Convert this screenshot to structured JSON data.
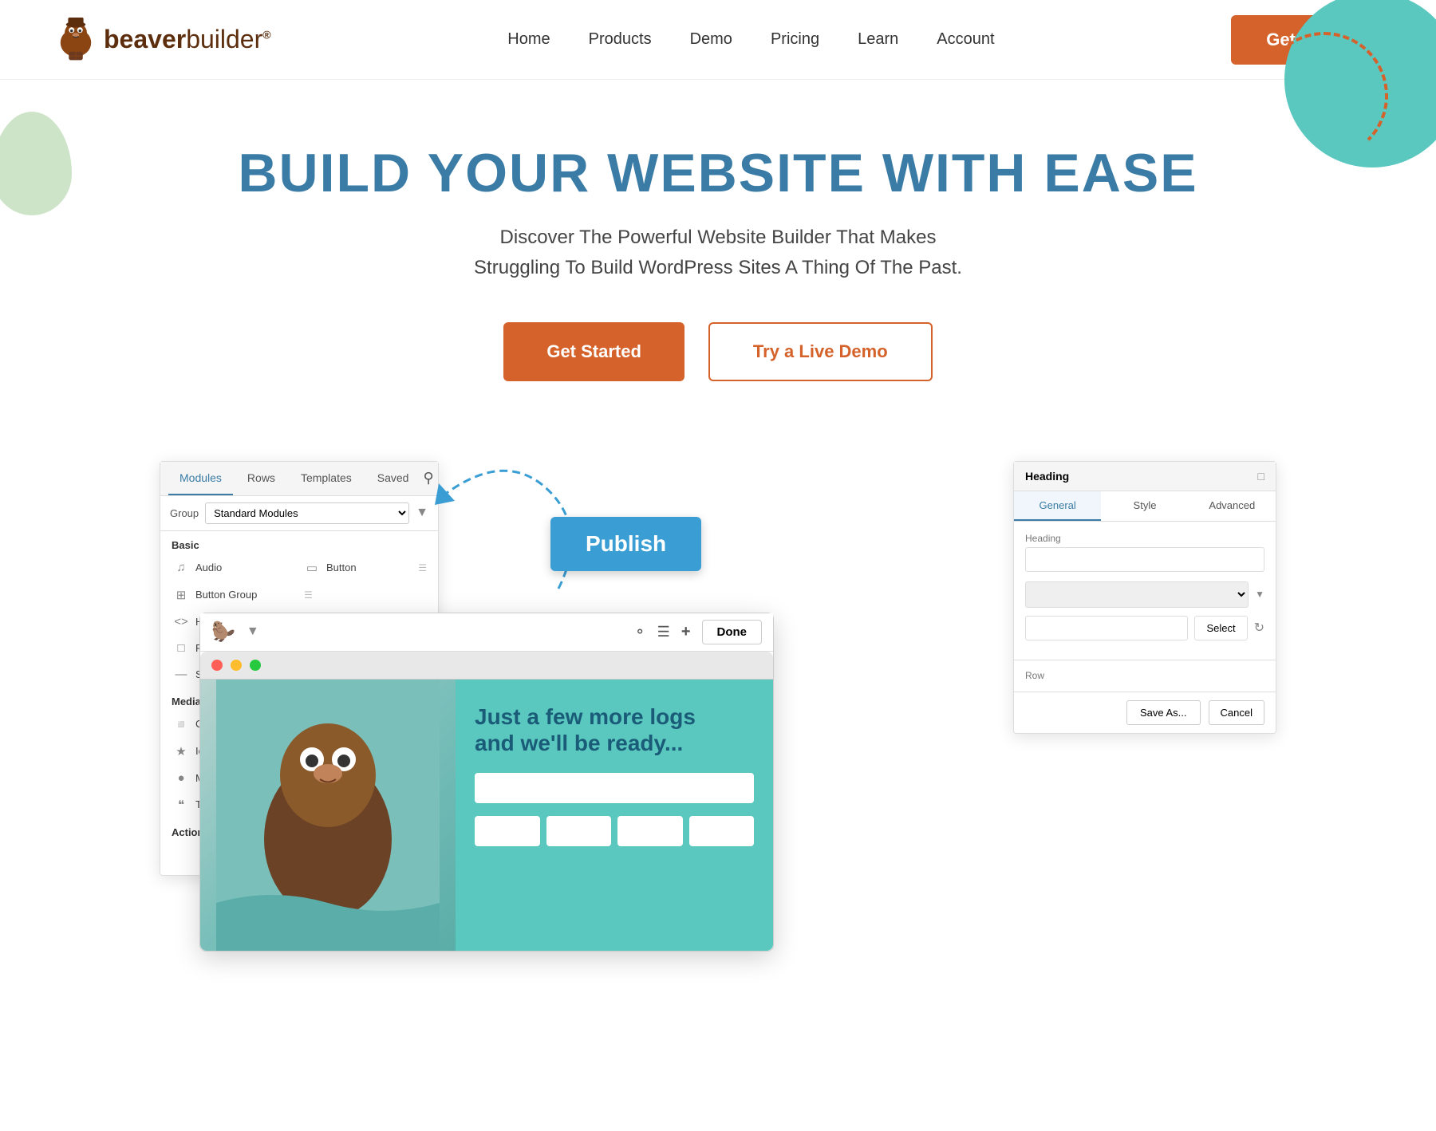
{
  "colors": {
    "orange": "#d4622a",
    "blue": "#3a7ca5",
    "teal": "#5bc8c0",
    "white": "#ffffff"
  },
  "navbar": {
    "logo_text_bold": "beaver",
    "logo_text_light": "builder",
    "logo_reg": "®",
    "nav_links": [
      {
        "label": "Home",
        "id": "home"
      },
      {
        "label": "Products",
        "id": "products"
      },
      {
        "label": "Demo",
        "id": "demo"
      },
      {
        "label": "Pricing",
        "id": "pricing"
      },
      {
        "label": "Learn",
        "id": "learn"
      },
      {
        "label": "Account",
        "id": "account"
      }
    ],
    "cta_label": "Get It Now"
  },
  "hero": {
    "headline": "BUILD YOUR WEBSITE WITH EASE",
    "subheadline": "Discover The Powerful Website Builder That Makes\nStruggling To Build WordPress Sites A Thing Of The Past.",
    "btn_primary": "Get Started",
    "btn_outline": "Try a Live Demo"
  },
  "modules_panel": {
    "tabs": [
      "Modules",
      "Rows",
      "Templates",
      "Saved"
    ],
    "active_tab": "Modules",
    "group_label": "Group",
    "group_value": "Standard Modules",
    "section_basic": "Basic",
    "items_basic": [
      {
        "icon": "♪",
        "label": "Audio",
        "col": "left"
      },
      {
        "icon": "▭",
        "label": "Button",
        "col": "right"
      },
      {
        "icon": "⊞",
        "label": "Button Group",
        "col": "left"
      },
      {
        "icon": "≡",
        "label": "",
        "col": "right_icon"
      },
      {
        "icon": "<>",
        "label": "HTML",
        "col": "left"
      },
      {
        "icon": "☰",
        "label": "",
        "col": "right_icon"
      },
      {
        "icon": "⊡",
        "label": "Photo",
        "col": "left"
      },
      {
        "icon": "≡",
        "label": "",
        "col": "right_icon"
      },
      {
        "icon": "—",
        "label": "Separator",
        "col": "left"
      },
      {
        "icon": "▣",
        "label": "",
        "col": "right_icon"
      }
    ],
    "section_media": "Media",
    "items_media": [
      {
        "icon": "◫",
        "label": "Content Slider"
      },
      {
        "icon": "★",
        "label": "Icon"
      },
      {
        "icon": "◎",
        "label": "Map"
      },
      {
        "icon": "❝",
        "label": "Testimonials"
      }
    ],
    "section_actions": "Actions"
  },
  "publish_button": {
    "label": "Publish"
  },
  "browser": {
    "title_text": "Just a few more logs\nand we'll be ready...",
    "done_label": "Done"
  },
  "heading_panel": {
    "title": "Heading",
    "tabs": [
      "General",
      "Style",
      "Advanced"
    ],
    "active_tab": "General",
    "field_label": "Heading",
    "select_placeholder": "",
    "select_btn": "Select",
    "save_label": "Save As...",
    "cancel_label": "Cancel"
  }
}
